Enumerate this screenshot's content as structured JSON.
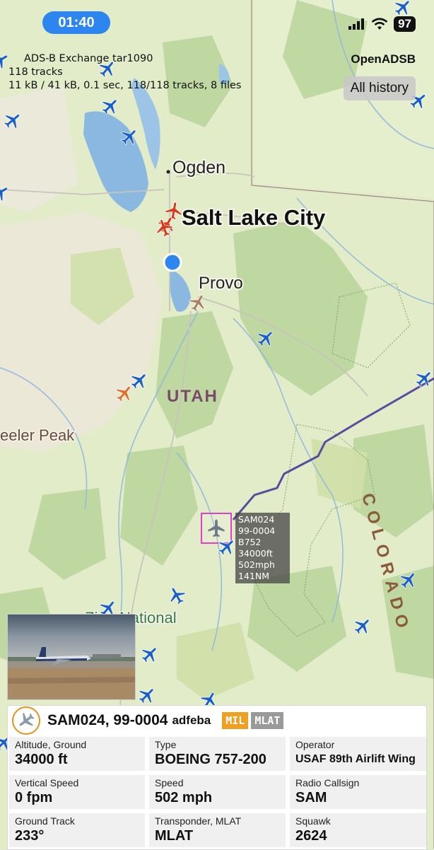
{
  "status_bar": {
    "time": "01:40",
    "battery": "97"
  },
  "app": {
    "title": "OpenADSB",
    "history_button": "All history"
  },
  "source_info": {
    "line1": "ADS-B Exchange tar1090",
    "line2": "118 tracks",
    "line3": "11 kB / 41 kB, 0.1 sec, 118/118 tracks, 8 files"
  },
  "map_labels": {
    "ogden": "Ogden",
    "salt_lake_city": "Salt Lake City",
    "provo": "Provo",
    "utah": "UTAH",
    "wheeler_peak": "eeler Peak",
    "zion": "Zion National",
    "colorado": "COLORADO"
  },
  "selected_label": [
    "SAM024",
    "99-0004",
    "B752",
    "34000ft",
    "502mph",
    "141NM"
  ],
  "aircraft": {
    "callsign": "SAM024, 99-0004",
    "hex": "adfeba",
    "badges": [
      "MIL",
      "MLAT"
    ],
    "badge_colors": [
      "#f0a020",
      "#9a9a9a"
    ]
  },
  "details": [
    {
      "label": "Altitude, Ground",
      "value": "34000 ft"
    },
    {
      "label": "Type",
      "value": "BOEING 757-200"
    },
    {
      "label": "Operator",
      "value": "USAF 89th Airlift Wing"
    },
    {
      "label": "Vertical Speed",
      "value": "0 fpm"
    },
    {
      "label": "Speed",
      "value": "502 mph"
    },
    {
      "label": "Radio Callsign",
      "value": "SAM"
    },
    {
      "label": "Ground Track",
      "value": "233°"
    },
    {
      "label": "Transponder, MLAT",
      "value": "MLAT"
    },
    {
      "label": "Squawk",
      "value": "2624"
    }
  ],
  "colors": {
    "plane_blue": "#1a5fc8",
    "plane_red": "#d63a1a",
    "plane_orange": "#e07028",
    "lake": "#8ab8e0",
    "track": "#5a4aa0"
  }
}
